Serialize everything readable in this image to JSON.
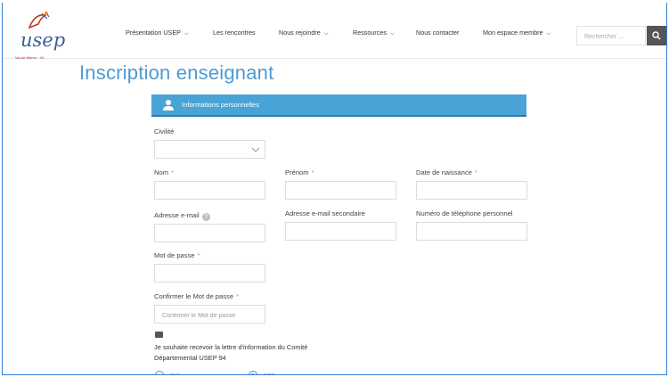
{
  "logo": {
    "text": "usep",
    "tagline": "Val-de-Marne · 94"
  },
  "nav": {
    "items": [
      {
        "label": "Présentation USEP",
        "dropdown": true
      },
      {
        "label": "Les rencontres",
        "dropdown": false
      },
      {
        "label": "Nous rejoindre",
        "dropdown": true
      },
      {
        "label": "Ressources",
        "dropdown": true
      },
      {
        "label": "Nous contacter",
        "dropdown": false
      },
      {
        "label": "Mon espace membre",
        "dropdown": true
      }
    ]
  },
  "search": {
    "placeholder": "Rechercher ...",
    "button_icon": "search-icon"
  },
  "page": {
    "title": "Inscription enseignant"
  },
  "section": {
    "title": "Informations personnelles",
    "icon": "person-icon",
    "color": "#4aa3d6"
  },
  "form": {
    "civilite": {
      "label": "Civilité",
      "value": ""
    },
    "nom": {
      "label": "Nom",
      "required": "*"
    },
    "prenom": {
      "label": "Prénom",
      "required": "*"
    },
    "date_naissance": {
      "label": "Date de naissance",
      "required": "*"
    },
    "email": {
      "label": "Adresse e-mail",
      "help_icon": "?"
    },
    "email_secondaire": {
      "label": "Adresse e-mail secondaire"
    },
    "telephone": {
      "label": "Numéro de téléphone personnel"
    },
    "mot_de_passe": {
      "label": "Mot de passe",
      "required": "*"
    },
    "confirmer_mdp": {
      "label": "Confirmer le Mot de passe",
      "required": "*",
      "placeholder": "Confirmer le Mot de passe"
    },
    "newsletter": {
      "label": "Je souhaite recevoir la lettre d'information du Comité Départemental USEP 94",
      "options": [
        {
          "label": "oui",
          "checked": false
        },
        {
          "label": "non",
          "checked": true
        }
      ]
    }
  }
}
